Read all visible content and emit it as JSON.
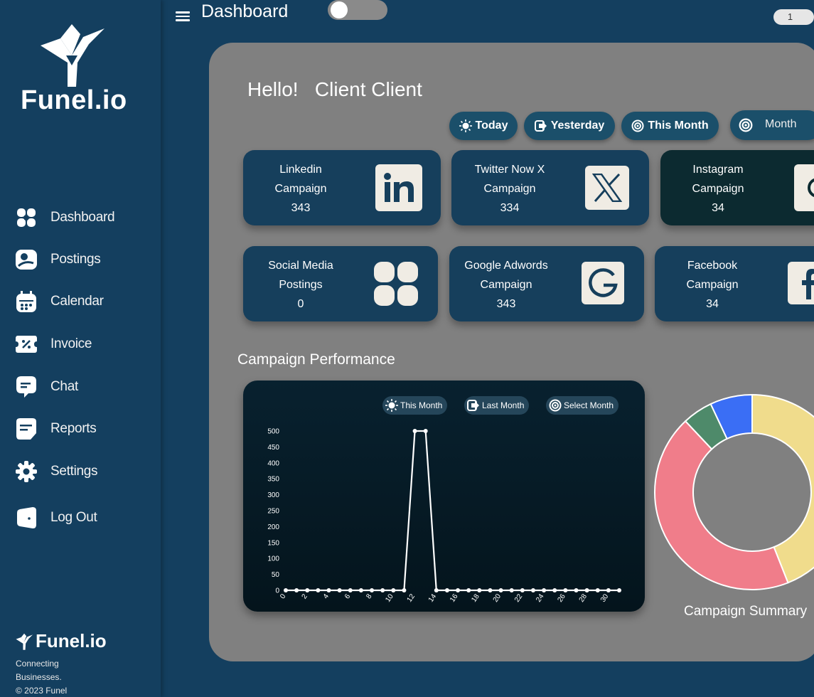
{
  "sidebar": {
    "logo_text": "Funel.io",
    "nav": [
      {
        "label": "Dashboard",
        "icon": "dashboard-icon"
      },
      {
        "label": "Postings",
        "icon": "postings-icon"
      },
      {
        "label": "Calendar",
        "icon": "calendar-icon"
      },
      {
        "label": "Invoice",
        "icon": "invoice-icon"
      },
      {
        "label": "Chat",
        "icon": "chat-icon"
      },
      {
        "label": "Reports",
        "icon": "reports-icon"
      },
      {
        "label": "Settings",
        "icon": "gear-icon"
      },
      {
        "label": "Log Out",
        "icon": "logout-icon"
      }
    ],
    "footer": {
      "logo_text": "Funel.io",
      "line1": "Connecting",
      "line2": "Businesses.",
      "line3": "© 2023 Funel"
    }
  },
  "header": {
    "title": "Dashboard",
    "badge": "1"
  },
  "greeting": "Hello!   Client Client",
  "filters": {
    "today": "Today",
    "yesterday": "Yesterday",
    "this_month": "This Month",
    "month_select": "Month"
  },
  "cards": [
    {
      "line1": "Linkedin",
      "line2": "Campaign",
      "value": "343",
      "icon": "linkedin-icon"
    },
    {
      "line1": "Twitter Now X",
      "line2": "Campaign",
      "value": "334",
      "icon": "x-icon"
    },
    {
      "line1": "Instagram",
      "line2": "Campaign",
      "value": "34",
      "icon": "instagram-icon"
    },
    {
      "line1": "Social Media",
      "line2": "Postings",
      "value": "0",
      "icon": "postings-grid-icon"
    },
    {
      "line1": "Google Adwords",
      "line2": "Campaign",
      "value": "343",
      "icon": "google-icon"
    },
    {
      "line1": "Facebook",
      "line2": "Campaign",
      "value": "34",
      "icon": "facebook-icon"
    }
  ],
  "performance": {
    "title": "Campaign Performance",
    "buttons": {
      "this_month": "This Month",
      "last_month": "Last Month",
      "select_month": "Select Month"
    }
  },
  "summary": {
    "title": "Campaign Summary"
  },
  "colors": {
    "background": "#143f5f",
    "panel": "#808080",
    "card": "#163f5c",
    "card_dark": "#0c2a30",
    "chart_bg": "#08212f"
  },
  "chart_data": [
    {
      "type": "line",
      "x": [
        0,
        1,
        2,
        3,
        4,
        5,
        6,
        7,
        8,
        9,
        10,
        11,
        12,
        13,
        14,
        15,
        16,
        17,
        18,
        19,
        20,
        21,
        22,
        23,
        24,
        25,
        26,
        27,
        28,
        29,
        30,
        31
      ],
      "series": [
        {
          "values": [
            0,
            0,
            0,
            0,
            0,
            0,
            0,
            0,
            0,
            0,
            0,
            0,
            500,
            500,
            0,
            0,
            0,
            0,
            0,
            0,
            0,
            0,
            0,
            0,
            0,
            0,
            0,
            0,
            0,
            0,
            0,
            0,
            0,
            0,
            0
          ]
        }
      ],
      "x_ticks": [
        "0",
        "2",
        "4",
        "6",
        "8",
        "10",
        "12",
        "14",
        "16",
        "18",
        "20",
        "22",
        "24",
        "26",
        "28",
        "30"
      ],
      "y_ticks": [
        "0",
        "50",
        "100",
        "150",
        "200",
        "250",
        "300",
        "350",
        "400",
        "450",
        "500"
      ],
      "ylim": [
        0,
        500
      ],
      "grid": false,
      "legend": "none"
    },
    {
      "type": "pie",
      "variant": "donut",
      "slices": [
        {
          "value": 44,
          "color": "#f0dc8c"
        },
        {
          "value": 44,
          "color": "#f07d8a"
        },
        {
          "value": 5,
          "color": "#4e8a6a"
        },
        {
          "value": 7,
          "color": "#3a6ef5"
        }
      ]
    }
  ]
}
